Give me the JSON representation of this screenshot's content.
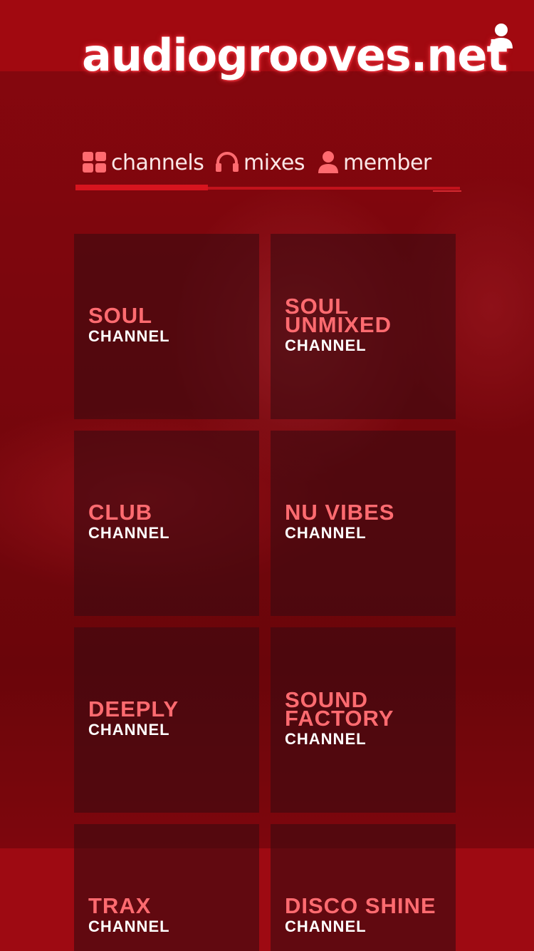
{
  "header": {
    "logo_text": "audiogrooves.net",
    "user_icon": "user-icon"
  },
  "nav": {
    "items": [
      {
        "label": "channels",
        "icon": "grid-icon"
      },
      {
        "label": "mixes",
        "icon": "headphones-icon"
      },
      {
        "label": "member",
        "icon": "user-icon"
      }
    ]
  },
  "channels": [
    {
      "name": "SOUL",
      "sub": "CHANNEL"
    },
    {
      "name": "SOUL\nUNMIXED",
      "sub": "CHANNEL"
    },
    {
      "name": "CLUB",
      "sub": "CHANNEL"
    },
    {
      "name": "NU VIBES",
      "sub": "CHANNEL"
    },
    {
      "name": "DEEPLY",
      "sub": "CHANNEL"
    },
    {
      "name": "SOUND\nFACTORY",
      "sub": "CHANNEL"
    },
    {
      "name": "TRAX",
      "sub": "CHANNEL"
    },
    {
      "name": "DISCO SHINE",
      "sub": "CHANNEL"
    }
  ],
  "colors": {
    "brand_red": "#a10910",
    "accent_pink": "#ff6b70",
    "tile_bg": "#3c0a10"
  }
}
